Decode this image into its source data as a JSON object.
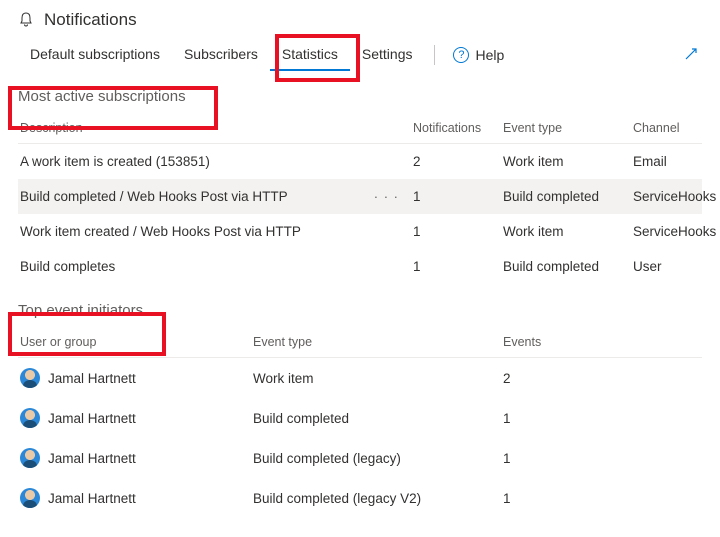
{
  "page": {
    "title": "Notifications"
  },
  "tabs": {
    "items": [
      {
        "label": "Default subscriptions",
        "active": false
      },
      {
        "label": "Subscribers",
        "active": false
      },
      {
        "label": "Statistics",
        "active": true
      },
      {
        "label": "Settings",
        "active": false
      }
    ],
    "help_label": "Help"
  },
  "sections": {
    "subscriptions": {
      "heading": "Most active subscriptions",
      "columns": {
        "description": "Description",
        "notifications": "Notifications",
        "event_type": "Event type",
        "channel": "Channel"
      },
      "rows": [
        {
          "description": "A work item is created (153851)",
          "notifications": "2",
          "event_type": "Work item",
          "channel": "Email",
          "hover": false,
          "more": false
        },
        {
          "description": "Build completed / Web Hooks Post via HTTP",
          "notifications": "1",
          "event_type": "Build completed",
          "channel": "ServiceHooks",
          "hover": true,
          "more": true
        },
        {
          "description": "Work item created / Web Hooks Post via HTTP",
          "notifications": "1",
          "event_type": "Work item",
          "channel": "ServiceHooks",
          "hover": false,
          "more": false
        },
        {
          "description": "Build completes",
          "notifications": "1",
          "event_type": "Build completed",
          "channel": "User",
          "hover": false,
          "more": false
        }
      ]
    },
    "initiators": {
      "heading": "Top event initiators",
      "columns": {
        "user": "User or group",
        "event_type": "Event type",
        "events": "Events"
      },
      "rows": [
        {
          "user": "Jamal Hartnett",
          "event_type": "Work item",
          "events": "2"
        },
        {
          "user": "Jamal Hartnett",
          "event_type": "Build completed",
          "events": "1"
        },
        {
          "user": "Jamal Hartnett",
          "event_type": "Build completed (legacy)",
          "events": "1"
        },
        {
          "user": "Jamal Hartnett",
          "event_type": "Build completed (legacy V2)",
          "events": "1"
        }
      ]
    }
  }
}
